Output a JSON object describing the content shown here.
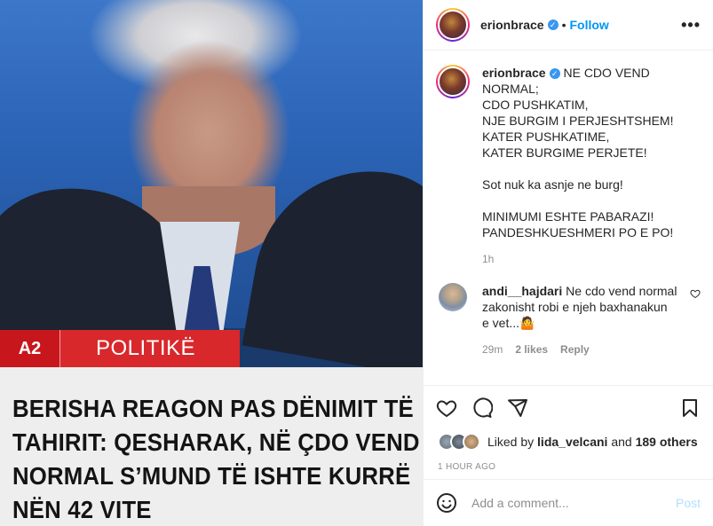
{
  "media": {
    "tag_logo": "A2",
    "tag_label": "POLITIKË",
    "headline": "BERISHA REAGON PAS DËNIMIT TË TAHIRIT: QESHARAK, NË ÇDO VEND NORMAL S’MUND TË ISHTE KURRË NËN 42 VITE"
  },
  "header": {
    "username": "erionbrace",
    "verified": "✓",
    "separator": "•",
    "follow_label": "Follow",
    "more_label": "•••"
  },
  "caption": {
    "username": "erionbrace",
    "text": "NE CDO VEND NORMAL;\nCDO PUSHKATIM,\nNJE BURGIM I PERJESHTSHEM!\nKATER PUSHKATIME,\nKATER BURGIME PERJETE!\n\nSot nuk ka asnje ne burg!\n\nMINIMUMI ESHTE PABARAZI!\nPANDESHKUESHMERI PO E PO!",
    "time": "1h"
  },
  "comment": {
    "username": "andi__hajdari",
    "text": "Ne cdo vend normal zakonisht robi e njeh baxhanakun e vet...",
    "emoji": "🤷",
    "time": "29m",
    "likes": "2 likes",
    "reply": "Reply"
  },
  "likes": {
    "prefix": "Liked by ",
    "user": "lida_velcani",
    "mid": " and ",
    "others": "189 others"
  },
  "posted_ago": "1 HOUR AGO",
  "add_comment": {
    "placeholder": "Add a comment...",
    "post_label": "Post"
  }
}
